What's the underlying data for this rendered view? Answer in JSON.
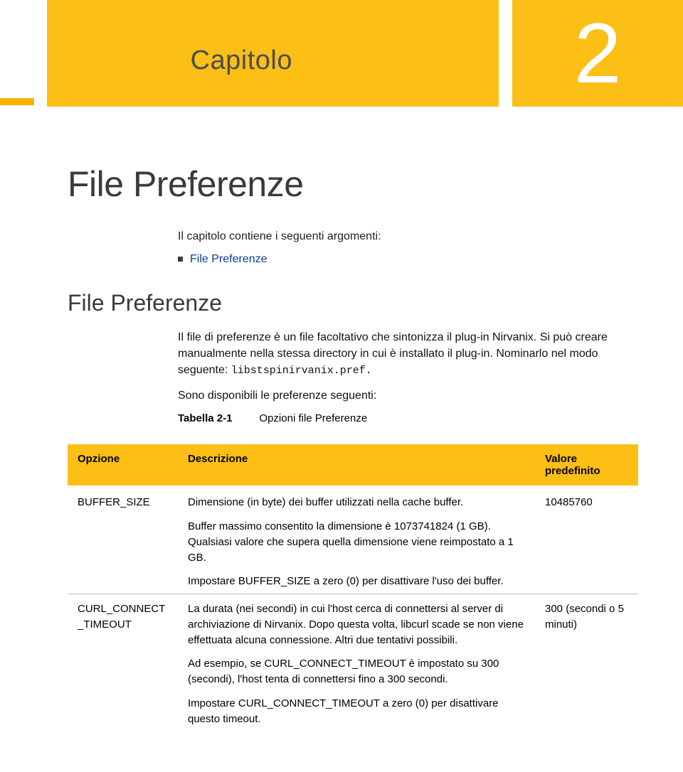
{
  "chapter": {
    "label": "Capitolo",
    "number": "2"
  },
  "page_title": "File Preferenze",
  "intro": {
    "lead": "Il capitolo contiene i seguenti argomenti:",
    "bullets": [
      {
        "text": "File Preferenze"
      }
    ]
  },
  "section_heading": "File Preferenze",
  "body": {
    "p1": "Il file di preferenze è un file facoltativo che sintonizza il plug-in Nirvanix. Si può creare manualmente nella stessa directory in cui è installato il plug-in. Nominarlo nel modo seguente: ",
    "p1_code": "libstspinirvanix.pref.",
    "p2": "Sono disponibili le preferenze seguenti:"
  },
  "table": {
    "caption_label": "Tabella 2-1",
    "caption_text": "Opzioni file Preferenze",
    "headers": {
      "option": "Opzione",
      "description": "Descrizione",
      "default": "Valore predefinito"
    },
    "rows": [
      {
        "option": "BUFFER_SIZE",
        "desc": [
          "Dimensione (in byte) dei buffer utilizzati nella cache buffer.",
          "Buffer massimo consentito la dimensione è 1073741824 (1 GB). Qualsiasi valore che supera quella dimensione viene reimpostato a 1 GB.",
          "Impostare BUFFER_SIZE a zero (0) per disattivare l'uso dei buffer."
        ],
        "default": "10485760"
      },
      {
        "option": "CURL_CONNECT_TIMEOUT",
        "desc": [
          "La durata (nei secondi) in cui l'host cerca di connettersi al server di archiviazione di Nirvanix. Dopo questa volta, libcurl scade se non viene effettuata alcuna connessione. Altri due tentativi possibili.",
          "Ad esempio, se CURL_CONNECT_TIMEOUT è impostato su 300 (secondi), l'host tenta di connettersi fino a 300 secondi.",
          "Impostare CURL_CONNECT_TIMEOUT a zero (0) per disattivare questo timeout."
        ],
        "default": "300 (secondi o 5 minuti)"
      }
    ]
  }
}
